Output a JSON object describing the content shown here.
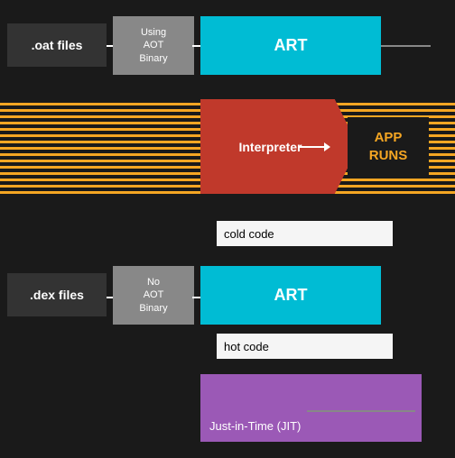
{
  "top": {
    "oat_label": ".oat files",
    "using_aot_label": "Using\nAOT\nBinary",
    "art_top_label": "ART"
  },
  "middle": {
    "interpreter_label": "Interpreter",
    "app_runs_label": "APP\nRUNS"
  },
  "cold_code": {
    "label": "cold code"
  },
  "bottom": {
    "dex_label": ".dex files",
    "no_aot_label": "No\nAOT\nBinary",
    "art_bottom_label": "ART"
  },
  "hot_code": {
    "label": "hot code"
  },
  "jit": {
    "label": "Just-in-Time (JIT)"
  },
  "colors": {
    "dark_bg": "#1a1a1a",
    "cyan": "#00bcd4",
    "red": "#c0392b",
    "orange": "#f5a623",
    "purple": "#9b59b6",
    "gray_box": "#888888",
    "dark_box": "#333333"
  }
}
